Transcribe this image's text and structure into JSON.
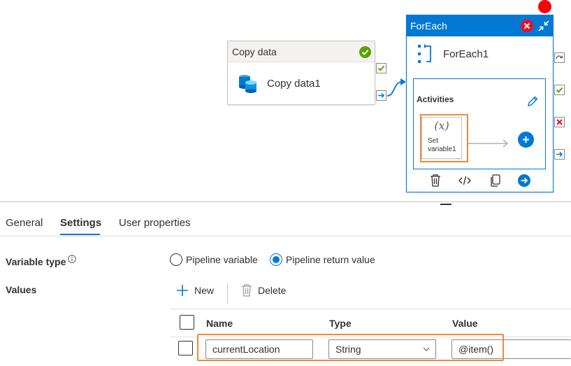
{
  "canvas": {
    "copy_activity": {
      "header": "Copy data",
      "name": "Copy data1",
      "status_color": "#57a300"
    },
    "foreach": {
      "header": "ForEach",
      "name": "ForEach1",
      "activities_label": "Activities",
      "inner_activity": {
        "icon": "function-x-icon",
        "icon_text": "(x)",
        "label_line1": "Set",
        "label_line2": "variable1"
      }
    },
    "accent_color": "#0078d4",
    "highlight_color": "#f0883e"
  },
  "tabs": [
    {
      "label": "General",
      "active": false
    },
    {
      "label": "Settings",
      "active": true
    },
    {
      "label": "User properties",
      "active": false
    }
  ],
  "settings": {
    "variable_type_label": "Variable type",
    "variable_type_options": [
      {
        "label": "Pipeline variable",
        "selected": false
      },
      {
        "label": "Pipeline return value",
        "selected": true
      }
    ],
    "values_label": "Values",
    "toolbar": {
      "new_label": "New",
      "delete_label": "Delete"
    },
    "table": {
      "columns": [
        "Name",
        "Type",
        "Value"
      ],
      "rows": [
        {
          "name": "currentLocation",
          "type": "String",
          "value": "@item()"
        }
      ]
    }
  }
}
